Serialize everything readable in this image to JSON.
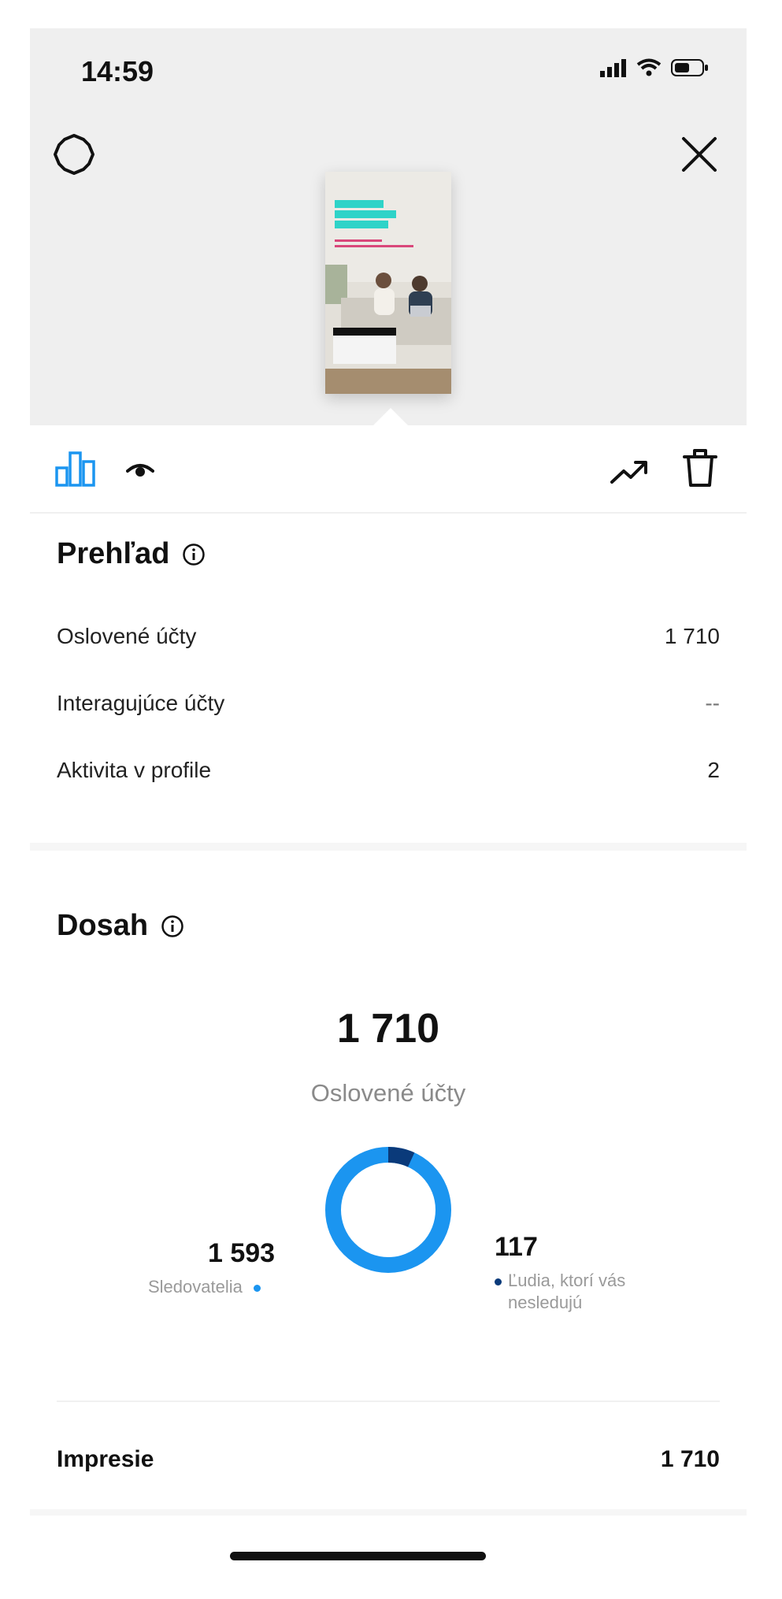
{
  "status_bar": {
    "time": "14:59"
  },
  "icons": {
    "settings": "settings-icon",
    "close": "close-icon",
    "insights_tab": "bar-chart-icon",
    "viewers_tab": "eye-icon",
    "promote": "trending-up-icon",
    "delete": "trash-icon"
  },
  "colors": {
    "accent": "#1b95f0",
    "followers": "#1b95f0",
    "non_followers": "#0a3a7a"
  },
  "overview": {
    "title": "Prehľad",
    "rows": [
      {
        "label": "Oslovené účty",
        "value": "1 710"
      },
      {
        "label": "Interagujúce účty",
        "value": "--"
      },
      {
        "label": "Aktivita v profile",
        "value": "2"
      }
    ]
  },
  "reach": {
    "title": "Dosah",
    "total": "1 710",
    "caption": "Oslovené účty",
    "followers": {
      "value": "1 593",
      "label": "Sledovatelia"
    },
    "non_followers": {
      "value": "117",
      "label_line1": "Ľudia, ktorí vás",
      "label_line2": "nesledujú"
    }
  },
  "chart_data": {
    "type": "pie",
    "categories": [
      "Sledovatelia",
      "Ľudia, ktorí vás nesledujú"
    ],
    "values": [
      1593,
      117
    ]
  },
  "impressions": {
    "label": "Impresie",
    "value": "1 710"
  }
}
